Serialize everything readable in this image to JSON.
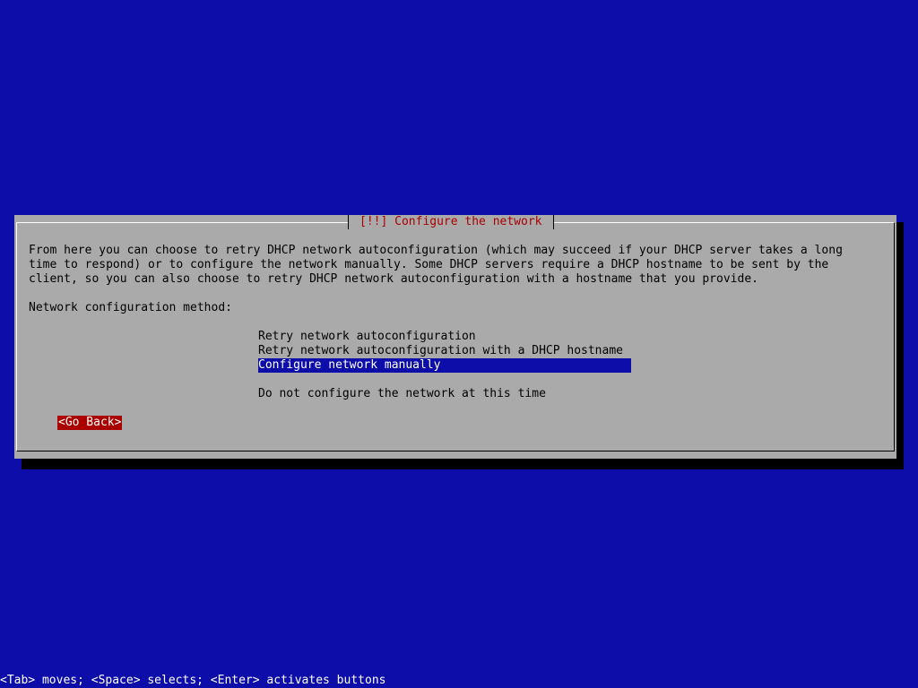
{
  "dialog": {
    "title": "[!!] Configure the network",
    "description": "From here you can choose to retry DHCP network autoconfiguration (which may succeed if your DHCP server takes a long\ntime to respond) or to configure the network manually. Some DHCP servers require a DHCP hostname to be sent by the\nclient, so you can also choose to retry DHCP network autoconfiguration with a hostname that you provide.",
    "prompt": "Network configuration method:",
    "options": [
      "Retry network autoconfiguration",
      "Retry network autoconfiguration with a DHCP hostname",
      "Configure network manually",
      "",
      "Do not configure the network at this time"
    ],
    "selected_option": "Configure network manually",
    "back_button": "<Go Back>"
  },
  "statusbar": {
    "help": "<Tab> moves; <Space> selects; <Enter> activates buttons"
  },
  "colors": {
    "background": "#0d0daa",
    "dialog": "#aaaaaa",
    "title_text": "#aa0000",
    "selection": "#0d0daa",
    "button": "#aa0000"
  }
}
